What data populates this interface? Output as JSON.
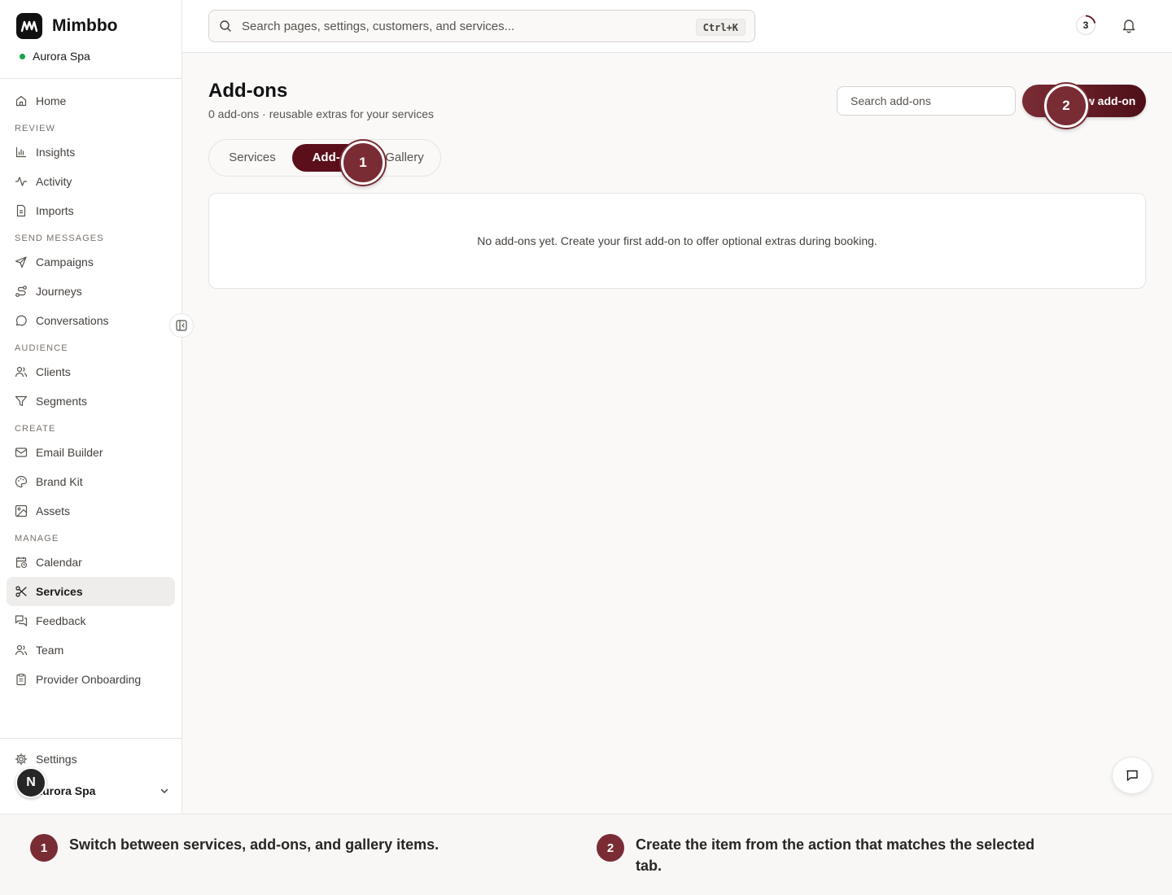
{
  "brand": {
    "name": "Mimbbo",
    "workspace": "Aurora Spa"
  },
  "search": {
    "placeholder": "Search pages, settings, customers, and services...",
    "shortcut": "Ctrl+K"
  },
  "topbar": {
    "progress_count": "3"
  },
  "sidebar": {
    "home": "Home",
    "sections": {
      "review": "REVIEW",
      "send": "SEND MESSAGES",
      "audience": "AUDIENCE",
      "create": "CREATE",
      "manage": "MANAGE"
    },
    "review_items": [
      "Insights",
      "Activity",
      "Imports"
    ],
    "send_items": [
      "Campaigns",
      "Journeys",
      "Conversations"
    ],
    "audience_items": [
      "Clients",
      "Segments"
    ],
    "create_items": [
      "Email Builder",
      "Brand Kit",
      "Assets"
    ],
    "manage_items": [
      "Calendar",
      "Services",
      "Feedback",
      "Team",
      "Provider Onboarding"
    ],
    "active_item": "Services",
    "settings": "Settings",
    "account_name": "Aurora Spa",
    "avatar_letter": "N"
  },
  "main": {
    "title": "Add-ons",
    "subtitle": "0 add-ons · reusable extras for your services",
    "search_placeholder": "Search add-ons",
    "new_button": "New add-on",
    "tabs": [
      "Services",
      "Add-ons",
      "Gallery"
    ],
    "active_tab": "Add-ons",
    "empty_message": "No add-ons yet. Create your first add-on to offer optional extras during booking."
  },
  "markers": [
    "1",
    "2"
  ],
  "notes": [
    {
      "num": "1",
      "text": "Switch between services, add-ons, and gallery items."
    },
    {
      "num": "2",
      "text": "Create the item from the action that matches the selected tab."
    }
  ],
  "colors": {
    "accent": "#5b0f1a",
    "marker": "#7a2c35",
    "status": "#16a34a"
  }
}
